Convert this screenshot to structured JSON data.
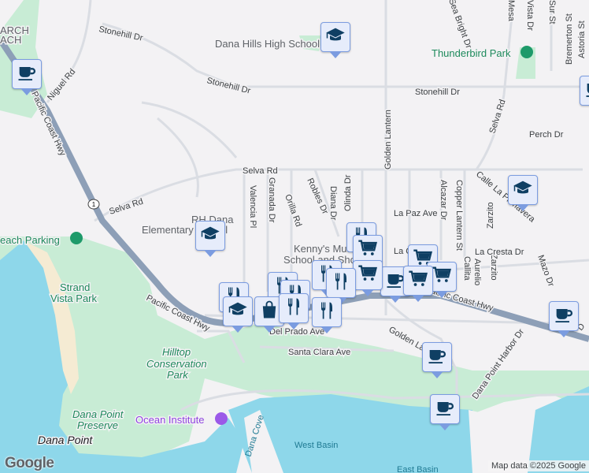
{
  "colors": {
    "water": "#8ed7ea",
    "park": "#c8ecd5",
    "road": "#dadde3",
    "highway": "#8d9fb7",
    "marker_bg": "#e6ecfb",
    "marker_border": "#7b9ce0",
    "icon": "#0f3f63"
  },
  "labels": {
    "arch_beach": "ARCH",
    "arch_beach2": "ACH",
    "stonehill_w": "Stonehill Dr",
    "stonehill_m": "Stonehill Dr",
    "stonehill_e": "Stonehill Dr",
    "niguel": "Niguel Rd",
    "pch_n": "Pacific Coast Hwy",
    "pch_s": "Pacific Coast Hwy",
    "pch_e": "Pacific Coast Hwy",
    "selva_w": "Selva Rd",
    "selva_m": "Selva Rd",
    "selva_e": "Selva Rd",
    "route_1": "1",
    "dana_hills": "Dana Hills High School",
    "thunderbird": "Thunderbird Park",
    "golden_lantern_n": "Golden Lantern",
    "golden_lantern_s": "Golden Lantern",
    "rh_dana": "RH Dana",
    "elementary": "Elementary School",
    "valencia": "Valencia Pl",
    "granada": "Granada Dr",
    "orilla": "Orilla Rd",
    "robles": "Robles Dr",
    "olinda": "Olinda Dr",
    "diana": "Diana Dr",
    "la_paz": "La Paz Ave",
    "alcazar": "Alcazar Dr",
    "copper_lantern": "Copper Lantern St",
    "calle_la_primavera": "Calle La Primavera",
    "zarzito": "Zarzito",
    "zarzito2": "Zarzito",
    "perch": "Perch Dr",
    "la_cresta": "La Cresta Dr",
    "aurelio": "Aurelio",
    "callita": "Callita",
    "mazo": "Mazo Dr",
    "kennys": "Kenny's Music",
    "kennys2": "School and Shop",
    "la_c": "La C",
    "sea_bright": "Sea Bright Dr",
    "mesa": "Mesa",
    "vista": "Vista Dr",
    "sur": "Sur St",
    "bremerton": "Bremerton St",
    "astoria": "Astoria St",
    "beach_parking": "each Parking",
    "strand": "Strand",
    "vista_park": "Vista Park",
    "del_prado": "Del Prado Ave",
    "santa_clara": "Santa Clara Ave",
    "hilltop": "Hilltop",
    "conservation": "Conservation",
    "park_word": "Park",
    "dp_preserve": "Dana Point",
    "dp_preserve2": "Preserve",
    "dana_point": "Dana Point",
    "ocean_institute": "Ocean Institute",
    "dana_cove": "Dana Cove",
    "west_basin": "West Basin",
    "east_basin": "East Basin",
    "dp_harbor": "Dana Point Harbor Dr",
    "dp_short": "D"
  },
  "markers": [
    {
      "type": "coffee"
    },
    {
      "type": "school"
    },
    {
      "type": "school"
    },
    {
      "type": "school"
    },
    {
      "type": "coffee"
    },
    {
      "type": "restaurant"
    },
    {
      "type": "grocery"
    },
    {
      "type": "grocery"
    },
    {
      "type": "grocery"
    },
    {
      "type": "coffee"
    },
    {
      "type": "grocery"
    },
    {
      "type": "grocery"
    },
    {
      "type": "restaurant"
    },
    {
      "type": "restaurant"
    },
    {
      "type": "restaurant"
    },
    {
      "type": "restaurant"
    },
    {
      "type": "restaurant"
    },
    {
      "type": "school"
    },
    {
      "type": "shopping"
    },
    {
      "type": "restaurant"
    },
    {
      "type": "restaurant"
    },
    {
      "type": "coffee"
    },
    {
      "type": "coffee"
    },
    {
      "type": "coffee"
    }
  ],
  "branding": {
    "logo": "Google",
    "attribution": "Map data ©2025 Google"
  }
}
